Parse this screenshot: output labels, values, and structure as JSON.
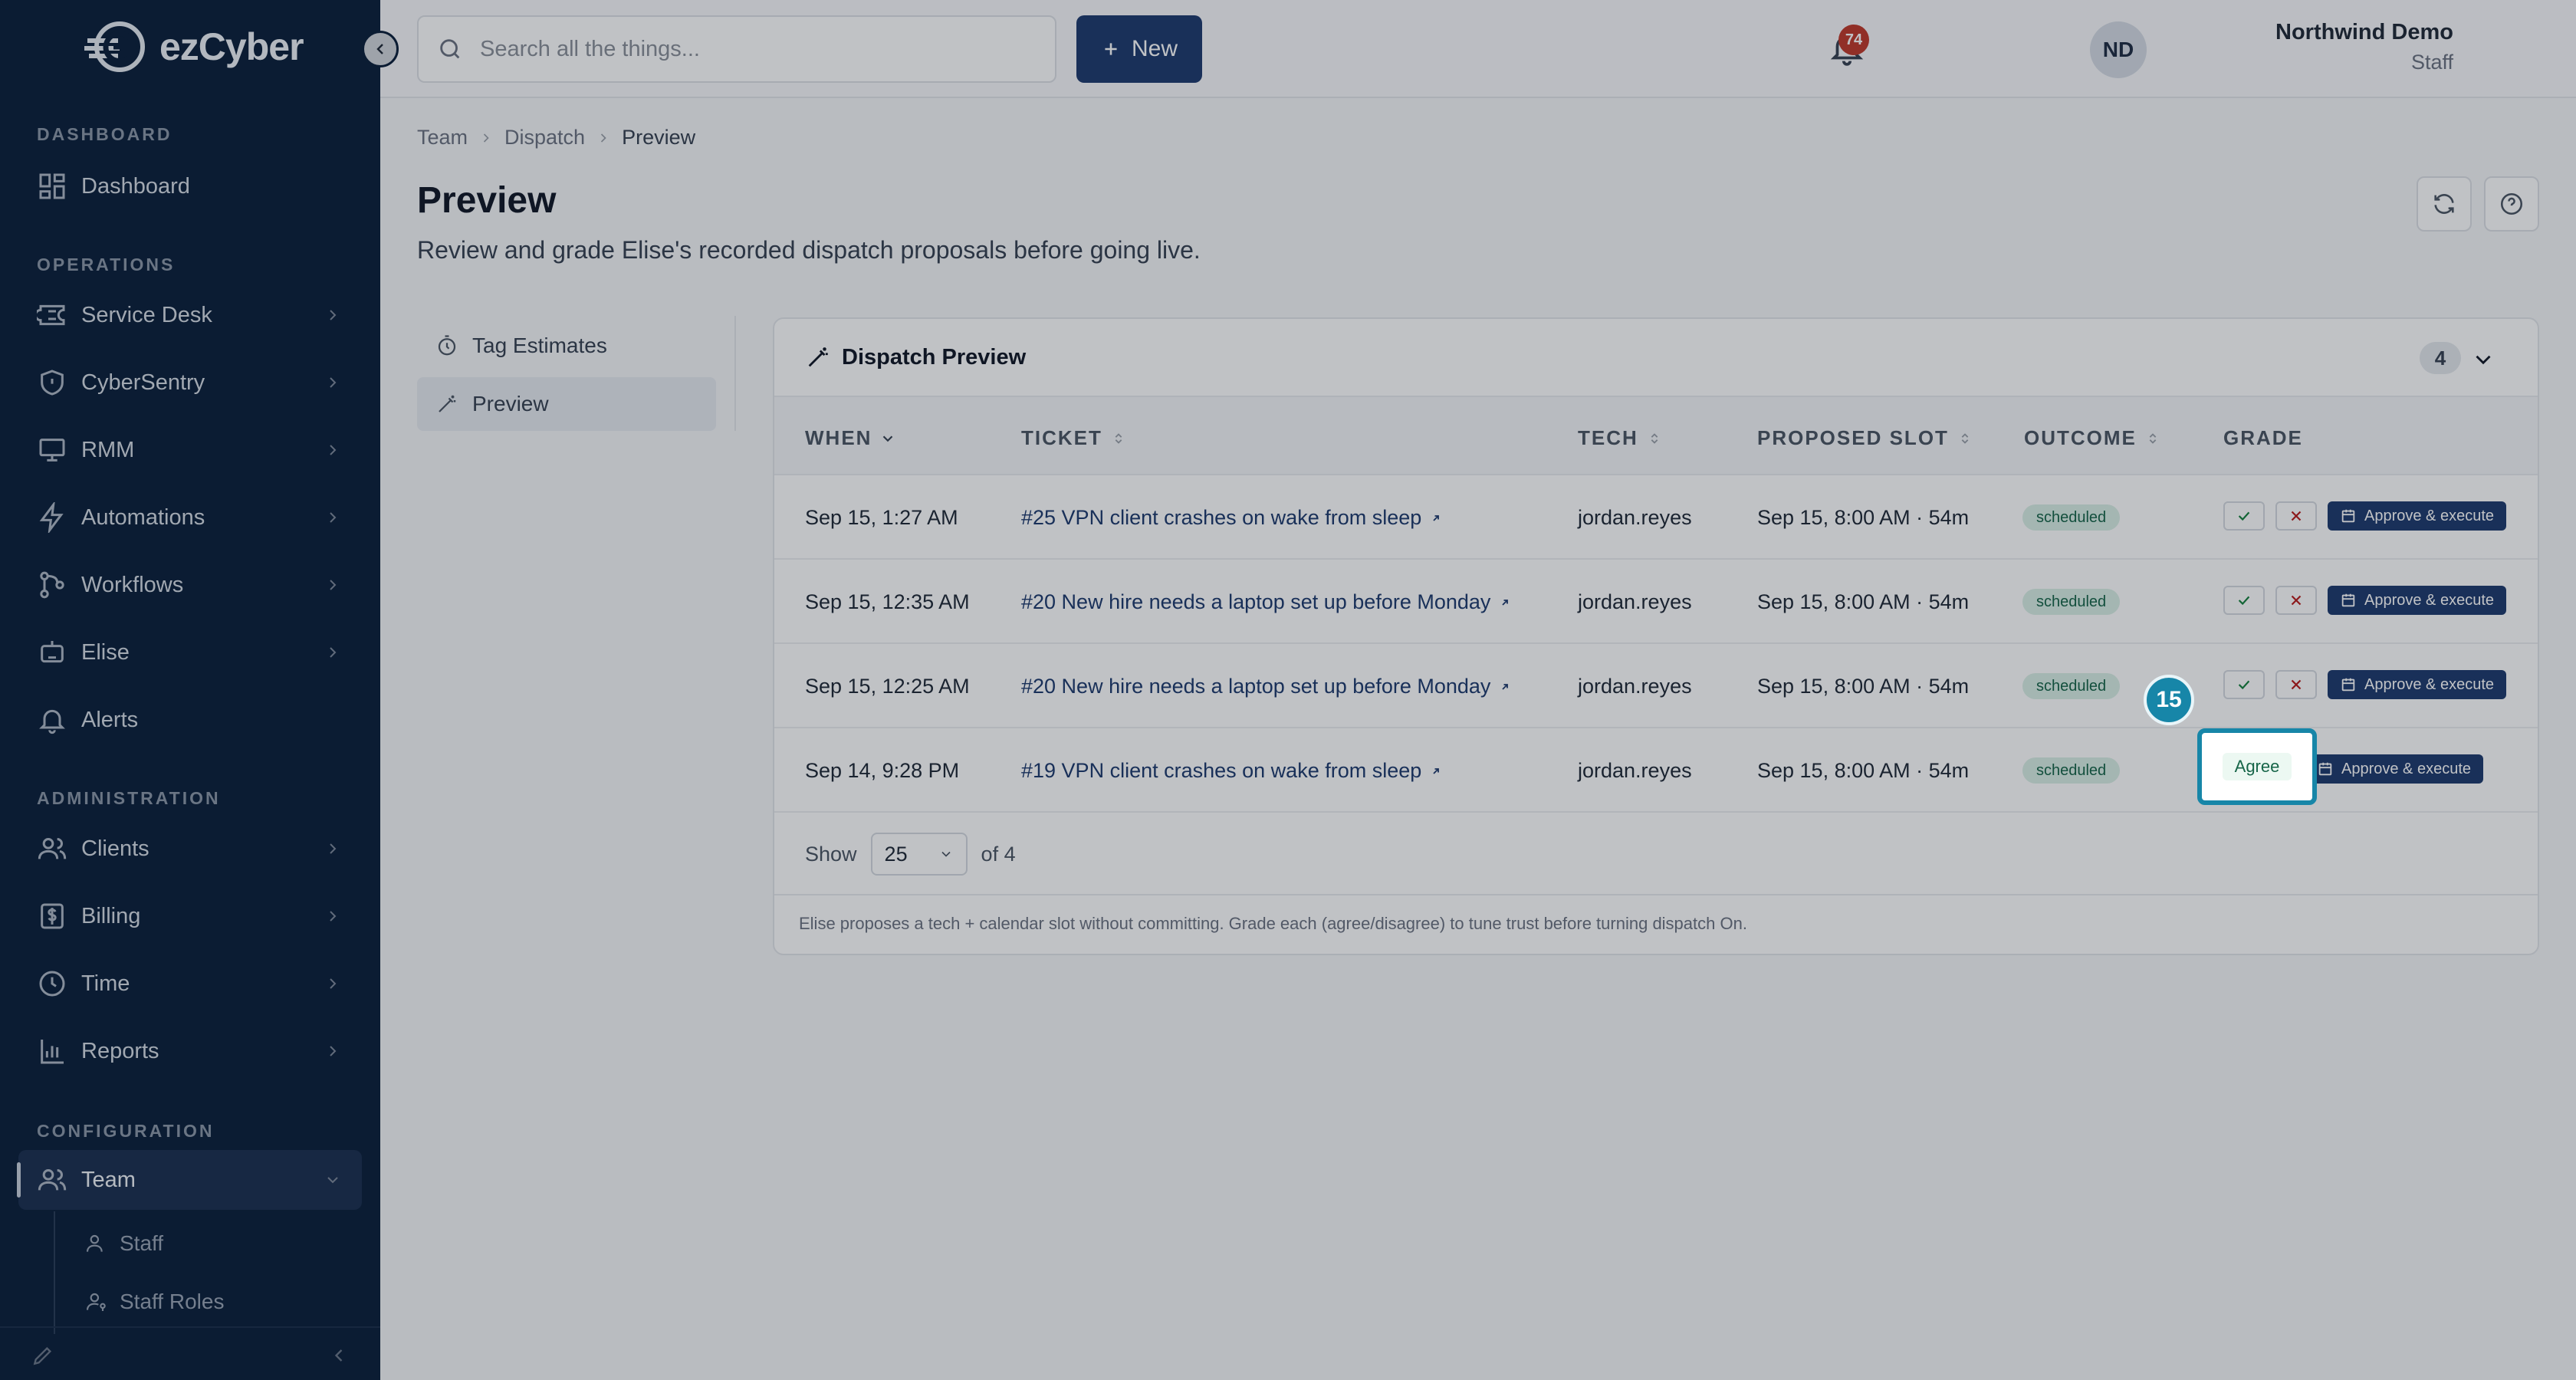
{
  "app": {
    "logo_text": "ezCyber"
  },
  "sidebar": {
    "sections": {
      "dashboard": "DASHBOARD",
      "operations": "OPERATIONS",
      "administration": "ADMINISTRATION",
      "configuration": "CONFIGURATION"
    },
    "items": [
      {
        "label": "Dashboard",
        "icon": "grid-icon"
      },
      {
        "label": "Service Desk",
        "icon": "ticket-icon"
      },
      {
        "label": "CyberSentry",
        "icon": "shield-icon"
      },
      {
        "label": "RMM",
        "icon": "monitor-icon"
      },
      {
        "label": "Automations",
        "icon": "bolt-icon"
      },
      {
        "label": "Workflows",
        "icon": "workflow-icon"
      },
      {
        "label": "Elise",
        "icon": "bot-icon"
      },
      {
        "label": "Alerts",
        "icon": "bell-icon"
      },
      {
        "label": "Clients",
        "icon": "users-icon"
      },
      {
        "label": "Billing",
        "icon": "dollar-icon"
      },
      {
        "label": "Time",
        "icon": "clock-icon"
      },
      {
        "label": "Reports",
        "icon": "chart-icon"
      },
      {
        "label": "Team",
        "icon": "team-icon"
      }
    ],
    "sub_items": [
      {
        "label": "Staff"
      },
      {
        "label": "Staff Roles"
      }
    ]
  },
  "header": {
    "search_placeholder": "Search all the things...",
    "new_label": "New",
    "notif_count": "74",
    "user_name": "Northwind Demo",
    "user_role": "Staff",
    "avatar_initials": "ND"
  },
  "breadcrumb": [
    "Team",
    "Dispatch",
    "Preview"
  ],
  "page": {
    "title": "Preview",
    "subtitle": "Review and grade Elise's recorded dispatch proposals before going live."
  },
  "subnav": [
    {
      "label": "Tag Estimates"
    },
    {
      "label": "Preview"
    }
  ],
  "card": {
    "title": "Dispatch Preview",
    "count": "4",
    "columns": [
      "WHEN",
      "TICKET",
      "TECH",
      "PROPOSED SLOT",
      "OUTCOME",
      "GRADE"
    ],
    "rows": [
      {
        "when": "Sep 15, 1:27 AM",
        "ticket": "#25 VPN client crashes on wake from sleep",
        "tech": "jordan.reyes",
        "slot": "Sep 15, 8:00 AM · 54m",
        "outcome": "scheduled",
        "action": "Approve & execute"
      },
      {
        "when": "Sep 15, 12:35 AM",
        "ticket": "#20 New hire needs a laptop set up before Monday",
        "tech": "jordan.reyes",
        "slot": "Sep 15, 8:00 AM · 54m",
        "outcome": "scheduled",
        "action": "Approve & execute"
      },
      {
        "when": "Sep 15, 12:25 AM",
        "ticket": "#20 New hire needs a laptop set up before Monday",
        "tech": "jordan.reyes",
        "slot": "Sep 15, 8:00 AM · 54m",
        "outcome": "scheduled",
        "action": "Approve & execute"
      },
      {
        "when": "Sep 14, 9:28 PM",
        "ticket": "#19 VPN client crashes on wake from sleep",
        "tech": "jordan.reyes",
        "slot": "Sep 15, 8:00 AM · 54m",
        "outcome": "scheduled",
        "action": "Approve & execute"
      }
    ],
    "show_label": "Show",
    "page_size": "25",
    "of_label": "of 4",
    "note": "Elise proposes a tech + calendar slot without committing. Grade each (agree/disagree) to tune trust before turning dispatch On."
  },
  "tour": {
    "step": "15",
    "highlight_label": "Agree"
  },
  "colors": {
    "sidebar_bg": "#0b1f3a",
    "accent": "#1e3a6e",
    "tour_accent": "#1786a8",
    "success": "#166548",
    "danger": "#b91c1c"
  }
}
